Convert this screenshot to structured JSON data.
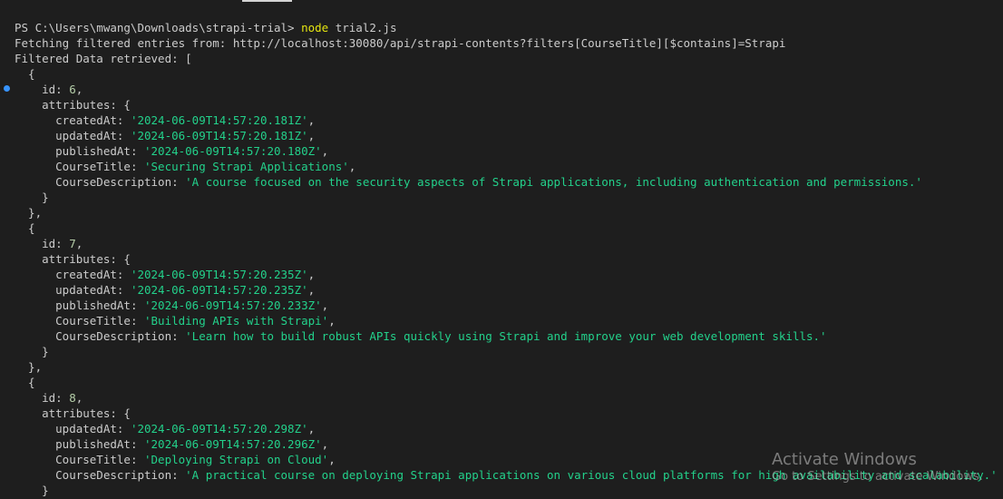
{
  "terminal": {
    "prompt": "PS C:\\Users\\mwang\\Downloads\\strapi-trial>",
    "command": "node",
    "command_args": "trial2.js",
    "fetch_message": "Fetching filtered entries from: http://localhost:30080/api/strapi-contents?filters[CourseTitle][$contains]=Strapi",
    "retrieved_message": "Filtered Data retrieved: [",
    "keys": {
      "id": "id:",
      "attributes": "attributes: {",
      "createdAt": "createdAt:",
      "updatedAt": "updatedAt:",
      "publishedAt": "publishedAt:",
      "CourseTitle": "CourseTitle:",
      "CourseDescription": "CourseDescription:"
    },
    "entries": [
      {
        "id": "6",
        "createdAt": "'2024-06-09T14:57:20.181Z'",
        "updatedAt": "'2024-06-09T14:57:20.181Z'",
        "publishedAt": "'2024-06-09T14:57:20.180Z'",
        "CourseTitle": "'Securing Strapi Applications'",
        "CourseDescription": "'A course focused on the security aspects of Strapi applications, including authentication and permissions.'"
      },
      {
        "id": "7",
        "createdAt": "'2024-06-09T14:57:20.235Z'",
        "updatedAt": "'2024-06-09T14:57:20.235Z'",
        "publishedAt": "'2024-06-09T14:57:20.233Z'",
        "CourseTitle": "'Building APIs with Strapi'",
        "CourseDescription": "'Learn how to build robust APIs quickly using Strapi and improve your web development skills.'"
      },
      {
        "id": "8",
        "updatedAt": "'2024-06-09T14:57:20.298Z'",
        "publishedAt": "'2024-06-09T14:57:20.296Z'",
        "CourseTitle": "'Deploying Strapi on Cloud'",
        "CourseDescription": "'A practical course on deploying Strapi applications on various cloud platforms for high availability and scalability.'"
      }
    ]
  },
  "watermark": {
    "title": "Activate Windows",
    "subtitle": "Go to Settings to activate Windows."
  }
}
